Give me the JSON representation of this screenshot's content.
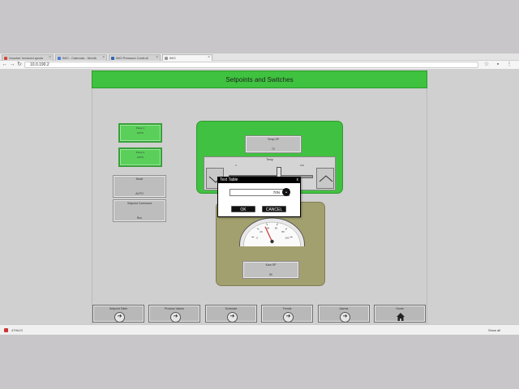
{
  "browser": {
    "tabs": [
      {
        "label": "Voucher Invoiced quota",
        "color": "#d14836"
      },
      {
        "label": "IMO - Calendar - Month",
        "color": "#4a7bd8"
      },
      {
        "label": "IMO Pressure Controll",
        "color": "#3264b4"
      },
      {
        "label": "IMO",
        "color": "#999999"
      }
    ],
    "url": "10.0.190.2",
    "download_item": "47Hk23",
    "show_all": "Show all"
  },
  "hmi": {
    "title": "Setpoints and Switches",
    "left_buttons": [
      {
        "title": "Pump 1",
        "value": "AUTO"
      },
      {
        "title": "Pump 2",
        "value": "AUTO"
      }
    ],
    "gray_buttons": [
      {
        "title": "Mode",
        "value": "AUTO"
      },
      {
        "title": "Setpoint Command",
        "value": "Run"
      }
    ],
    "temp_sp": {
      "title": "Temp SP",
      "value": "72"
    },
    "slider": {
      "label": "Temp",
      "min": "0",
      "max": "100",
      "level": 0.6
    },
    "gauge": {
      "ticks": [
        "0",
        "20",
        "40",
        "60",
        "80",
        "100"
      ],
      "value": 35
    },
    "bottom_field": {
      "title": "Kam SP",
      "value": "50"
    },
    "nav": [
      {
        "label": "Setpoint Table",
        "icon": "arrow-icon"
      },
      {
        "label": "Process Values",
        "icon": "arrow-icon"
      },
      {
        "label": "Schedule",
        "icon": "arrow-icon"
      },
      {
        "label": "Trends",
        "icon": "arrow-icon"
      },
      {
        "label": "Alarms",
        "icon": "arrow-icon"
      },
      {
        "label": "Home",
        "icon": "home-icon"
      }
    ]
  },
  "dialog": {
    "title": "Text Table",
    "close": "x",
    "value": "70N",
    "ok": "OK",
    "cancel": "CANCEL"
  }
}
